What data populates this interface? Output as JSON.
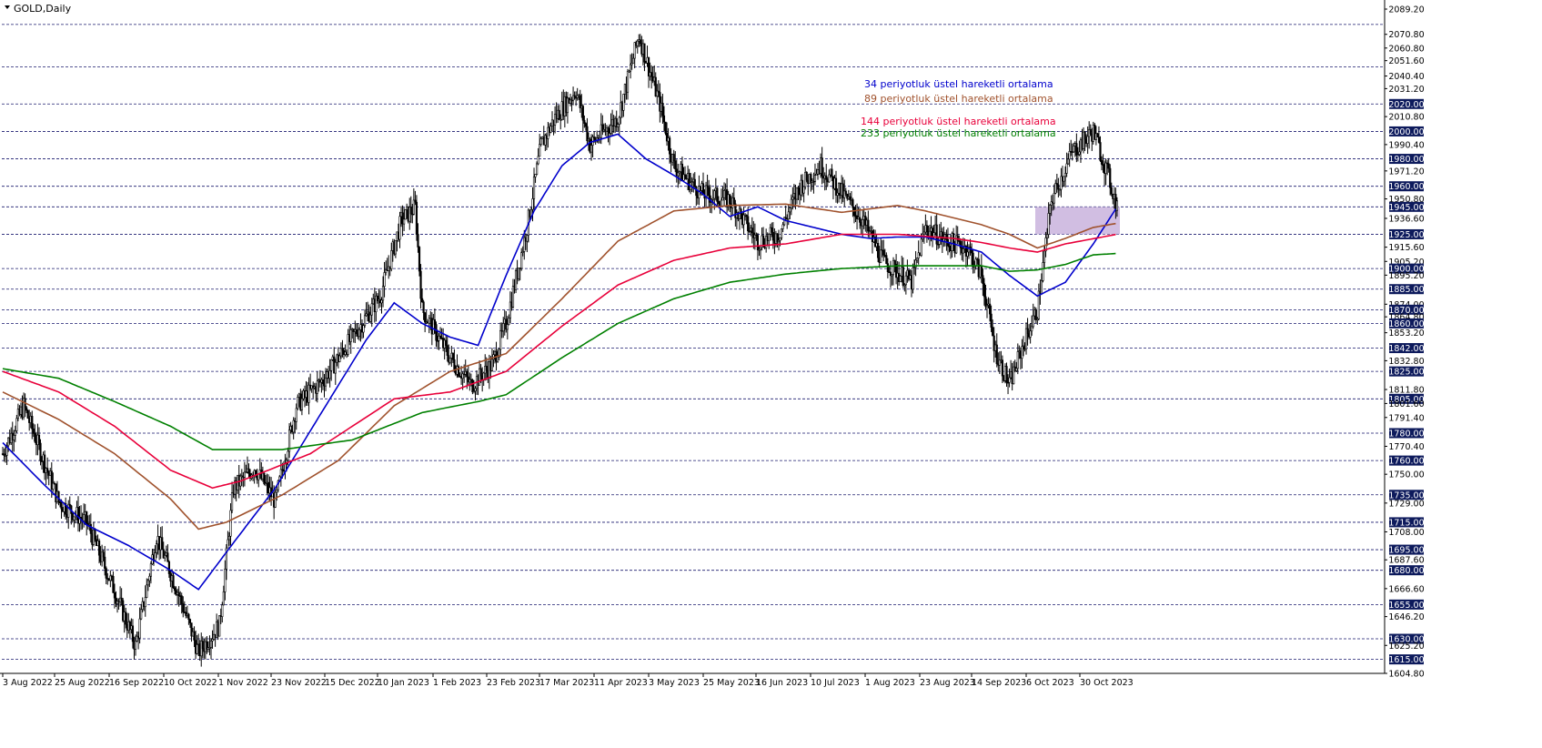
{
  "header": {
    "symbol": "GOLD,Daily"
  },
  "chart_data": {
    "type": "candlestick",
    "title": "GOLD,Daily",
    "y_range": [
      1604.8,
      2089.2
    ],
    "grid": false,
    "x_tick_labels": [
      "3 Aug 2022",
      "25 Aug 2022",
      "16 Sep 2022",
      "10 Oct 2022",
      "1 Nov 2022",
      "23 Nov 2022",
      "15 Dec 2022",
      "10 Jan 2023",
      "1 Feb 2023",
      "23 Feb 2023",
      "17 Mar 2023",
      "11 Apr 2023",
      "3 May 2023",
      "25 May 2023",
      "16 Jun 2023",
      "10 Jul 2023",
      "1 Aug 2023",
      "23 Aug 2023",
      "14 Sep 2023",
      "6 Oct 2023",
      "30 Oct 2023"
    ],
    "y_tick_labels": [
      "2089.20",
      "2070.80",
      "2060.80",
      "2051.60",
      "2040.40",
      "2031.20",
      "2020.00",
      "2010.80",
      "2000.00",
      "1990.40",
      "1980.00",
      "1971.20",
      "1960.00",
      "1950.80",
      "1945.00",
      "1936.60",
      "1925.00",
      "1915.60",
      "1905.20",
      "1900.00",
      "1895.20",
      "1885.00",
      "1874.00",
      "1870.00",
      "1864.80",
      "1860.00",
      "1853.20",
      "1842.00",
      "1832.80",
      "1825.00",
      "1811.80",
      "1805.00",
      "1801.60",
      "1791.40",
      "1780.00",
      "1770.40",
      "1760.00",
      "1750.00",
      "1735.00",
      "1729.00",
      "1715.00",
      "1708.00",
      "1695.00",
      "1687.60",
      "1680.00",
      "1666.60",
      "1655.00",
      "1646.20",
      "1630.00",
      "1625.20",
      "1615.00",
      "1604.80"
    ],
    "horizontal_levels": [
      "2078.00",
      "2047.00",
      "2020.00",
      "2000.00",
      "1980.00",
      "1960.00",
      "1945.00",
      "1925.00",
      "1900.00",
      "1885.00",
      "1870.00",
      "1860.00",
      "1842.00",
      "1825.00",
      "1805.00",
      "1780.00",
      "1760.00",
      "1735.00",
      "1715.00",
      "1695.00",
      "1680.00",
      "1655.00",
      "1630.00",
      "1615.00"
    ],
    "series": [
      {
        "name": "34 periyotluk üstel hareketli ortalama",
        "color": "#0000cc",
        "points": [
          [
            0,
            1773
          ],
          [
            30,
            1742
          ],
          [
            60,
            1713
          ],
          [
            90,
            1698
          ],
          [
            120,
            1680
          ],
          [
            140,
            1666
          ],
          [
            165,
            1700
          ],
          [
            195,
            1740
          ],
          [
            225,
            1790
          ],
          [
            260,
            1848
          ],
          [
            280,
            1875
          ],
          [
            300,
            1860
          ],
          [
            320,
            1850
          ],
          [
            340,
            1844
          ],
          [
            360,
            1895
          ],
          [
            380,
            1942
          ],
          [
            400,
            1975
          ],
          [
            420,
            1992
          ],
          [
            440,
            1998
          ],
          [
            460,
            1980
          ],
          [
            480,
            1968
          ],
          [
            500,
            1955
          ],
          [
            520,
            1938
          ],
          [
            540,
            1945
          ],
          [
            560,
            1935
          ],
          [
            580,
            1930
          ],
          [
            600,
            1925
          ],
          [
            620,
            1922
          ],
          [
            640,
            1923
          ],
          [
            660,
            1923
          ],
          [
            680,
            1918
          ],
          [
            700,
            1912
          ],
          [
            720,
            1895
          ],
          [
            740,
            1880
          ],
          [
            760,
            1890
          ],
          [
            780,
            1918
          ],
          [
            797,
            1945
          ]
        ]
      },
      {
        "name": "89 periyotluk üstel hareketli ortalama",
        "color": "#a0522d",
        "points": [
          [
            0,
            1810
          ],
          [
            40,
            1790
          ],
          [
            80,
            1765
          ],
          [
            120,
            1732
          ],
          [
            140,
            1710
          ],
          [
            160,
            1715
          ],
          [
            200,
            1735
          ],
          [
            240,
            1760
          ],
          [
            280,
            1800
          ],
          [
            320,
            1825
          ],
          [
            360,
            1838
          ],
          [
            400,
            1878
          ],
          [
            440,
            1920
          ],
          [
            480,
            1942
          ],
          [
            520,
            1946
          ],
          [
            560,
            1947
          ],
          [
            600,
            1941
          ],
          [
            640,
            1946
          ],
          [
            660,
            1942
          ],
          [
            700,
            1932
          ],
          [
            720,
            1925
          ],
          [
            740,
            1915
          ],
          [
            760,
            1922
          ],
          [
            780,
            1930
          ],
          [
            797,
            1933
          ]
        ]
      },
      {
        "name": "144 periyotluk üstel hareketli ortalama",
        "color": "#e8003a",
        "points": [
          [
            0,
            1825
          ],
          [
            40,
            1810
          ],
          [
            80,
            1785
          ],
          [
            120,
            1753
          ],
          [
            150,
            1740
          ],
          [
            170,
            1745
          ],
          [
            220,
            1765
          ],
          [
            280,
            1805
          ],
          [
            320,
            1810
          ],
          [
            360,
            1825
          ],
          [
            400,
            1858
          ],
          [
            440,
            1888
          ],
          [
            480,
            1906
          ],
          [
            520,
            1915
          ],
          [
            560,
            1918
          ],
          [
            600,
            1925
          ],
          [
            640,
            1925
          ],
          [
            680,
            1922
          ],
          [
            700,
            1919
          ],
          [
            720,
            1915
          ],
          [
            740,
            1912
          ],
          [
            760,
            1918
          ],
          [
            797,
            1925
          ]
        ]
      },
      {
        "name": "233 periyotluk üstel hareketli ortalama",
        "color": "#008000",
        "points": [
          [
            0,
            1827
          ],
          [
            40,
            1820
          ],
          [
            80,
            1803
          ],
          [
            120,
            1785
          ],
          [
            150,
            1768
          ],
          [
            200,
            1768
          ],
          [
            250,
            1775
          ],
          [
            300,
            1795
          ],
          [
            340,
            1803
          ],
          [
            360,
            1808
          ],
          [
            400,
            1835
          ],
          [
            440,
            1860
          ],
          [
            480,
            1878
          ],
          [
            520,
            1890
          ],
          [
            560,
            1896
          ],
          [
            600,
            1900
          ],
          [
            640,
            1902
          ],
          [
            680,
            1902
          ],
          [
            700,
            1902
          ],
          [
            720,
            1898
          ],
          [
            740,
            1899
          ],
          [
            760,
            1903
          ],
          [
            780,
            1910
          ],
          [
            797,
            1911
          ]
        ]
      }
    ]
  }
}
